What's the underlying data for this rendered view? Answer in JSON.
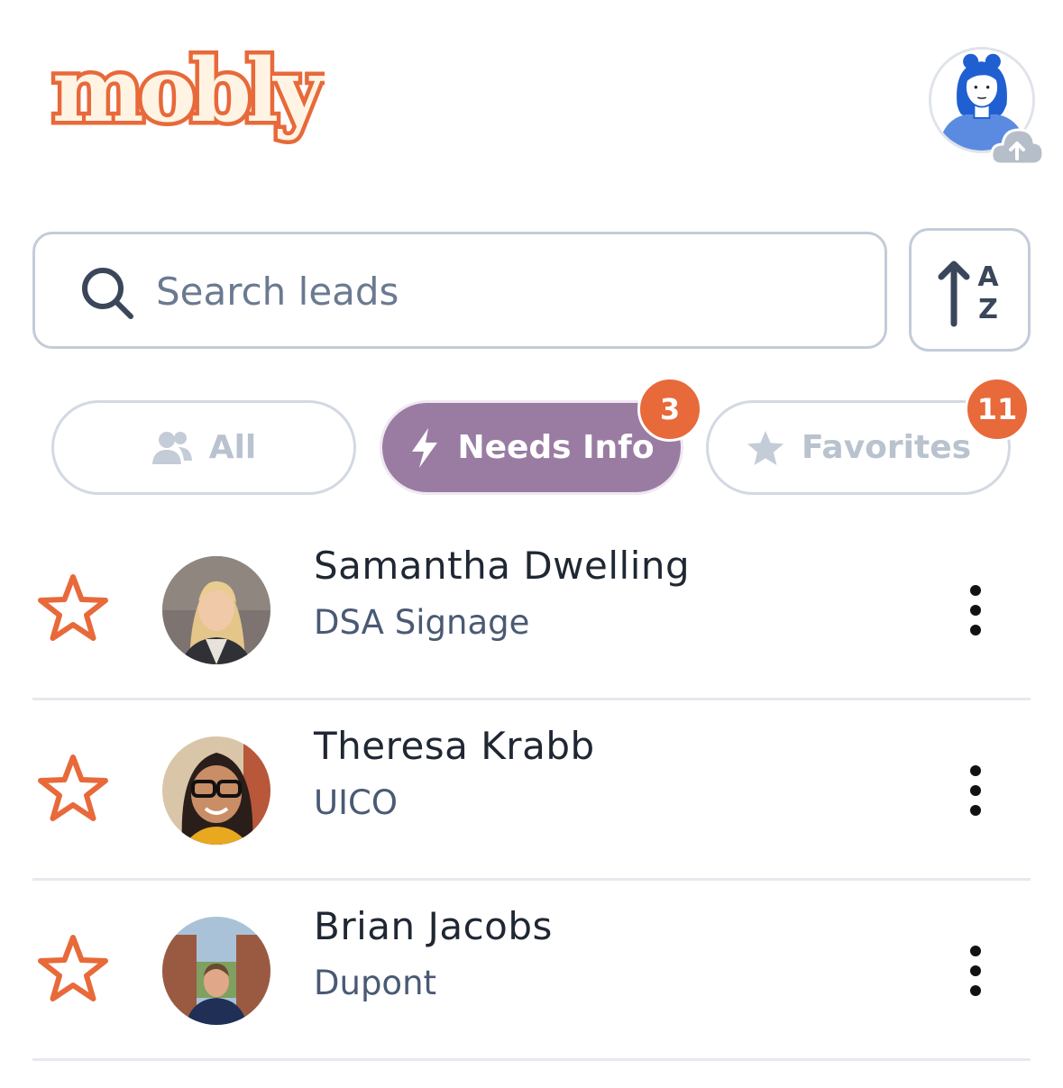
{
  "app": {
    "logo_text": "mobly",
    "brand_color": "#e8693a",
    "logo_fill": "#fff4e4"
  },
  "profile": {
    "icon": "user-avatar-icon",
    "upload_icon": "cloud-upload-icon"
  },
  "search": {
    "placeholder": "Search leads",
    "value": "",
    "icon": "search-icon"
  },
  "sort": {
    "icon": "sort-alpha-asc-icon"
  },
  "filters": [
    {
      "label": "All",
      "icon": "users-icon",
      "active": false,
      "count": null
    },
    {
      "label": "Needs Info",
      "icon": "lightning-icon",
      "active": true,
      "count": "3"
    },
    {
      "label": "Favorites",
      "icon": "star-icon",
      "active": false,
      "count": "11"
    }
  ],
  "leads": [
    {
      "name": "Samantha Dwelling",
      "company": "DSA Signage",
      "favorite": false
    },
    {
      "name": "Theresa Krabb",
      "company": "UICO",
      "favorite": false
    },
    {
      "name": "Brian Jacobs",
      "company": "Dupont",
      "favorite": false
    }
  ],
  "colors": {
    "accent": "#e8693a",
    "active_filter": "#9a7ca3",
    "text_primary": "#1f2733",
    "text_secondary": "#4a5a75"
  }
}
